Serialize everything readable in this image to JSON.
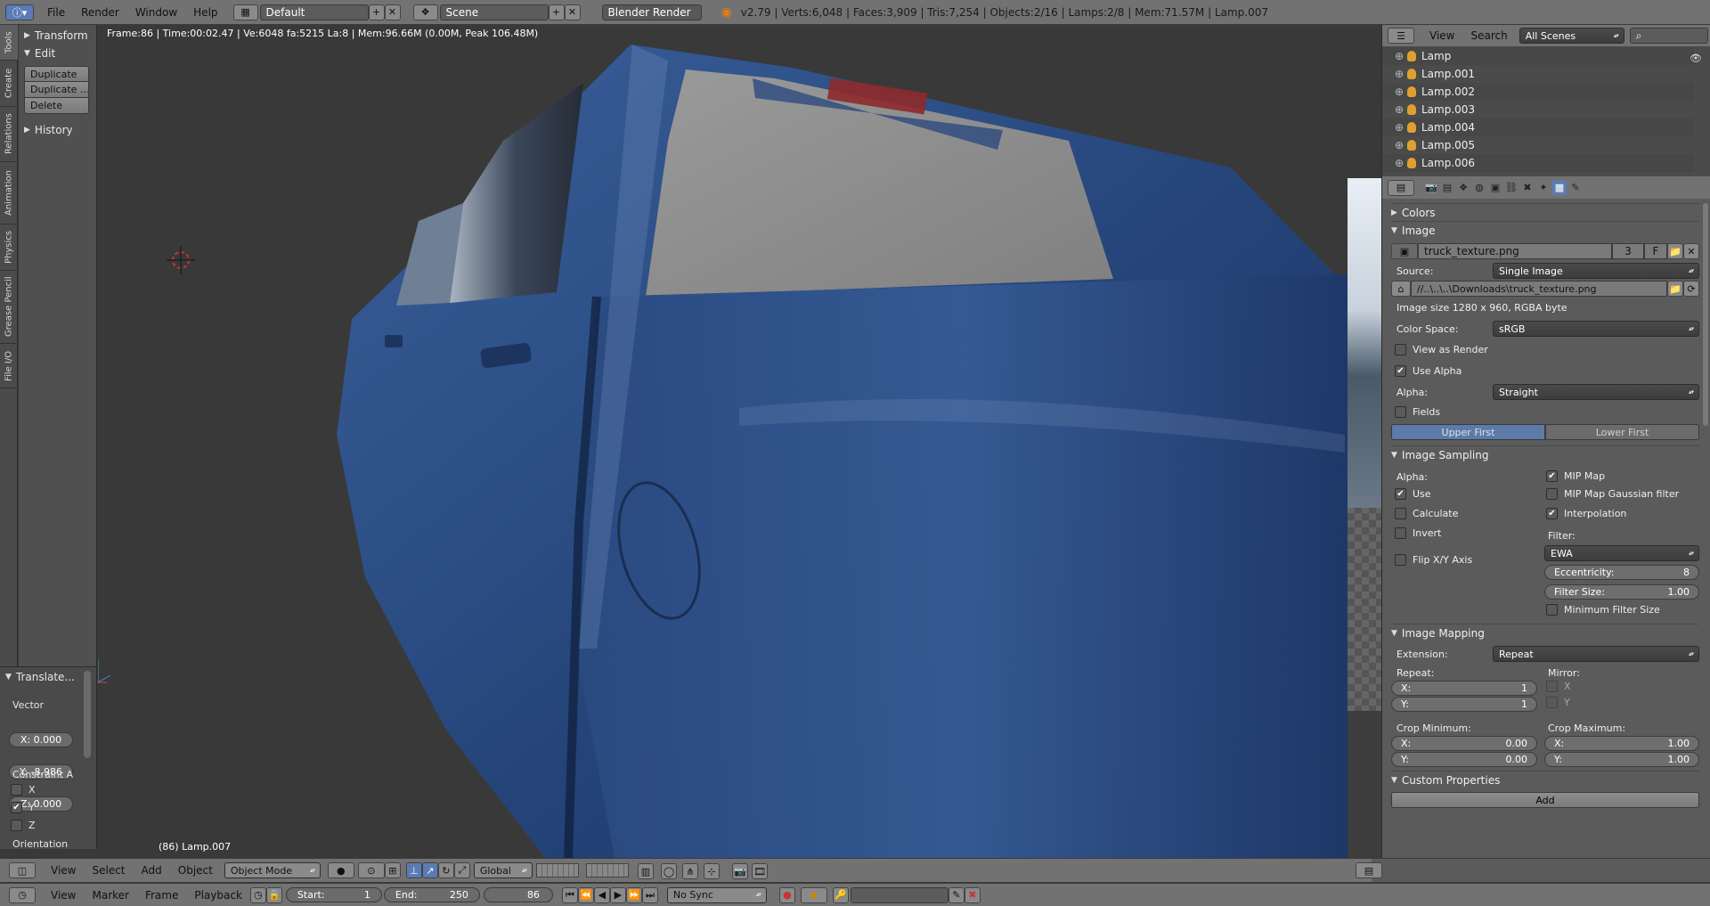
{
  "topbar": {
    "menus": [
      "File",
      "Render",
      "Window",
      "Help"
    ],
    "screen_layout": "Default",
    "scene": "Scene",
    "engine": "Blender Render",
    "stats": "v2.79 | Verts:6,048 | Faces:3,909 | Tris:7,254 | Objects:2/16 | Lamps:2/8 | Mem:71.57M | Lamp.007"
  },
  "left_tabs": [
    "Tools",
    "Create",
    "Relations",
    "Animation",
    "Physics",
    "Grease Pencil",
    "File I/O"
  ],
  "toolshelf": {
    "transform": "Transform",
    "edit": "Edit",
    "buttons": [
      "Duplicate",
      "Duplicate ...",
      "Delete"
    ],
    "history": "History"
  },
  "operator": {
    "title": "Translate...",
    "vector_label": "Vector",
    "x": "X: 0.000",
    "y": "Y: -8.986",
    "z": "Z: 0.000",
    "constraint_label": "Constraint A",
    "axes": [
      "X",
      "Y",
      "Z"
    ],
    "axes_checked": [
      false,
      true,
      false
    ],
    "orientation": "Orientation"
  },
  "viewport": {
    "info": "Frame:86 | Time:00:02.47 | Ve:6048 fa:5215 La:8 | Mem:96.66M (0.00M, Peak 106.48M)",
    "object_name": "(86) Lamp.007"
  },
  "vpheader": {
    "menus": [
      "View",
      "Select",
      "Add",
      "Object"
    ],
    "mode": "Object Mode",
    "orientation": "Global"
  },
  "timeline": {
    "menus": [
      "View",
      "Marker",
      "Frame",
      "Playback"
    ],
    "start": "Start:",
    "start_val": "1",
    "end": "End:",
    "end_val": "250",
    "current": "86",
    "sync": "No Sync"
  },
  "outliner": {
    "menus": [
      "View",
      "Search"
    ],
    "scenes": "All Scenes",
    "items": [
      "Lamp",
      "Lamp.001",
      "Lamp.002",
      "Lamp.003",
      "Lamp.004",
      "Lamp.005",
      "Lamp.006"
    ]
  },
  "props": {
    "colors": "Colors",
    "image": "Image",
    "image_name": "truck_texture.png",
    "users": "3",
    "fake": "F",
    "source_label": "Source:",
    "source": "Single Image",
    "filepath": "//..\\..\\..\\Downloads\\truck_texture.png",
    "size_info": "Image size 1280 x 960, RGBA byte",
    "colorspace_label": "Color Space:",
    "colorspace": "sRGB",
    "view_as_render": "View as Render",
    "use_alpha": "Use Alpha",
    "alpha_label": "Alpha:",
    "alpha": "Straight",
    "fields": "Fields",
    "upper_first": "Upper First",
    "lower_first": "Lower First",
    "sampling": "Image Sampling",
    "s_alpha": "Alpha:",
    "s_use": "Use",
    "s_calc": "Calculate",
    "s_invert": "Invert",
    "s_flip": "Flip X/Y Axis",
    "mipmap": "MIP Map",
    "mipmap_gauss": "MIP Map Gaussian filter",
    "interp": "Interpolation",
    "filter_label": "Filter:",
    "filter": "EWA",
    "eccentricity": "Eccentricity:",
    "ecc_val": "8",
    "filter_size": "Filter Size:",
    "fs_val": "1.00",
    "min_filter": "Minimum Filter Size",
    "mapping": "Image Mapping",
    "extension_label": "Extension:",
    "extension": "Repeat",
    "repeat": "Repeat:",
    "mirror": "Mirror:",
    "rx": "X:",
    "rx_val": "1",
    "ry": "Y:",
    "ry_val": "1",
    "mx": "X",
    "my": "Y",
    "crop_min": "Crop Minimum:",
    "crop_max": "Crop Maximum:",
    "cminx": "X:",
    "cminx_val": "0.00",
    "cminy": "Y:",
    "cminy_val": "0.00",
    "cmaxx": "X:",
    "cmaxx_val": "1.00",
    "cmaxy": "Y:",
    "cmaxy_val": "1.00",
    "custom": "Custom Properties",
    "add": "Add"
  }
}
